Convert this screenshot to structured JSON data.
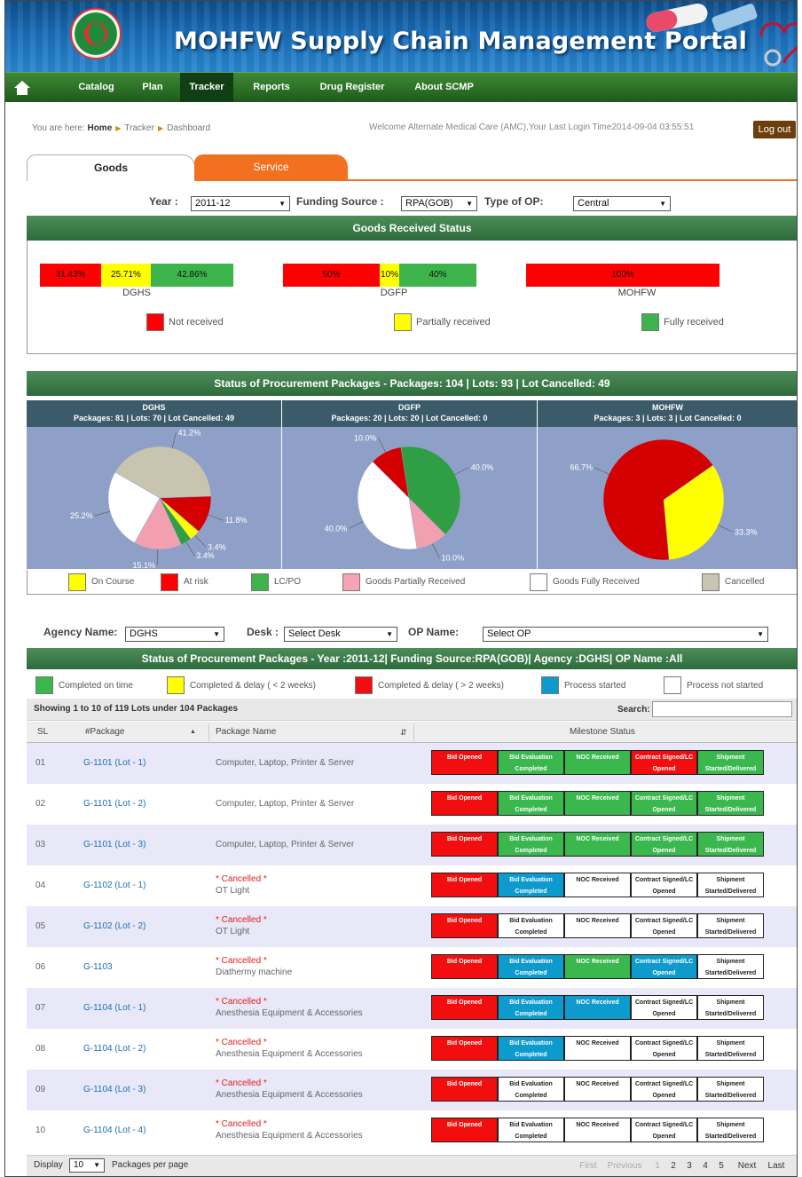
{
  "portal": {
    "title": "MOHFW Supply Chain Management Portal"
  },
  "nav": {
    "items": [
      "Catalog",
      "Plan",
      "Tracker",
      "Reports",
      "Drug Register",
      "About SCMP"
    ],
    "active": "Tracker"
  },
  "breadcrumb": {
    "prefix": "You are here:",
    "home": "Home",
    "tracker": "Tracker",
    "dashboard": "Dashboard"
  },
  "welcome": "Welcome Alternate Medical Care (AMC),Your Last Login Time2014-09-04 03:55:51",
  "logout_label": "Log out",
  "tabs": {
    "goods": "Goods",
    "service": "Service"
  },
  "filters": {
    "year_label": "Year :",
    "year_value": "2011-12",
    "funding_label": "Funding Source :",
    "funding_value": "RPA(GOB)",
    "op_type_label": "Type of OP:",
    "op_type_value": "Central"
  },
  "goods_status": {
    "title": "Goods Received Status",
    "bars": [
      {
        "name": "DGHS",
        "not_received": "31.43%",
        "partial": "25.71%",
        "full": "42.86%",
        "fractions": [
          0.3143,
          0.2571,
          0.4286
        ]
      },
      {
        "name": "DGFP",
        "not_received": "50%",
        "partial": "10%",
        "full": "40%",
        "fractions": [
          0.5,
          0.1,
          0.4
        ]
      },
      {
        "name": "MOHFW",
        "not_received": "100%",
        "partial": "",
        "full": "",
        "fractions": [
          1.0,
          0,
          0
        ]
      }
    ],
    "legend": {
      "not_received": "Not received",
      "partial": "Partially received",
      "full": "Fully received"
    },
    "colors": {
      "not_received": "#ff0000",
      "partial": "#ffff00",
      "full": "#3cb44b"
    }
  },
  "procurement": {
    "title": "Status of Procurement Packages - Packages: 104 | Lots: 93 | Lot Cancelled: 49",
    "panes": [
      {
        "name": "DGHS",
        "sub": "Packages: 81 | Lots: 70 | Lot Cancelled: 49"
      },
      {
        "name": "DGFP",
        "sub": "Packages: 20 | Lots: 20 | Lot Cancelled: 0"
      },
      {
        "name": "MOHFW",
        "sub": "Packages: 3 | Lots: 3 | Lot Cancelled: 0"
      }
    ],
    "legend": [
      "On Course",
      "At risk",
      "LC/PO",
      "Goods Partially Received",
      "Goods Fully Received",
      "Cancelled"
    ],
    "legend_colors": [
      "#ffff00",
      "#ff0000",
      "#3cb44b",
      "#f4a4b4",
      "#ffffff",
      "#c8c4b0"
    ]
  },
  "chart_data": [
    {
      "type": "pie",
      "title": "DGHS",
      "slices": [
        {
          "label": "Cancelled",
          "value": 41.2,
          "text": "41.2%"
        },
        {
          "label": "At risk",
          "value": 11.8,
          "text": "11.8%"
        },
        {
          "label": "On Course",
          "value": 3.4,
          "text": "3.4%"
        },
        {
          "label": "LC/PO",
          "value": 3.4,
          "text": "3.4%"
        },
        {
          "label": "Goods Partially Received",
          "value": 15.1,
          "text": "15.1%"
        },
        {
          "label": "Goods Fully Received",
          "value": 25.2,
          "text": "25.2%"
        }
      ]
    },
    {
      "type": "pie",
      "title": "DGFP",
      "slices": [
        {
          "label": "At risk",
          "value": 10.0,
          "text": "10.0%"
        },
        {
          "label": "LC/PO",
          "value": 40.0,
          "text": "40.0%"
        },
        {
          "label": "Goods Partially Received",
          "value": 10.0,
          "text": "10.0%"
        },
        {
          "label": "Goods Fully Received",
          "value": 40.0,
          "text": "40.0%"
        }
      ]
    },
    {
      "type": "pie",
      "title": "MOHFW",
      "slices": [
        {
          "label": "On Course",
          "value": 33.3,
          "text": "33.3%"
        },
        {
          "label": "At risk",
          "value": 66.7,
          "text": "66.7%"
        }
      ]
    }
  ],
  "agency_filter": {
    "agency_label": "Agency Name:",
    "agency_value": "DGHS",
    "desk_label": "Desk :",
    "desk_value": "Select Desk",
    "op_label": "OP Name:",
    "op_value": "Select OP"
  },
  "status_table": {
    "title": "Status of Procurement Packages - Year :2011-12| Funding Source:RPA(GOB)| Agency :DGHS| OP Name :All",
    "legend": [
      "Completed on time",
      "Completed & delay ( < 2 weeks)",
      "Completed & delay ( > 2 weeks)",
      "Process started",
      "Process not started"
    ],
    "legend_colors": [
      "#3ab74d",
      "#ffff00",
      "#f20e0e",
      "#0d9acd",
      "#ffffff"
    ],
    "showing": "Showing 1 to 10 of 119 Lots under 104 Packages",
    "search_label": "Search:",
    "headers": {
      "sl": "SL",
      "package": "#Package",
      "name": "Package Name",
      "milestone": "Milestone Status"
    },
    "milestones": [
      "Bid Opened",
      "Bid Evaluation Completed",
      "NOC Received",
      "Contract Signed/LC Opened",
      "Shipment Started/Delivered"
    ],
    "rows": [
      {
        "sl": "01",
        "pkg": "G-1101  (Lot - 1)",
        "cancel": "",
        "name": "Computer, Laptop, Printer & Server",
        "status": [
          "red",
          "green",
          "green",
          "red",
          "green"
        ]
      },
      {
        "sl": "02",
        "pkg": "G-1101  (Lot - 2)",
        "cancel": "",
        "name": "Computer, Laptop, Printer & Server",
        "status": [
          "red",
          "green",
          "green",
          "green",
          "green"
        ]
      },
      {
        "sl": "03",
        "pkg": "G-1101  (Lot - 3)",
        "cancel": "",
        "name": "Computer, Laptop, Printer & Server",
        "status": [
          "red",
          "green",
          "green",
          "green",
          "green"
        ]
      },
      {
        "sl": "04",
        "pkg": "G-1102  (Lot - 1)",
        "cancel": "* Cancelled *",
        "name": "OT Light",
        "status": [
          "red",
          "blue",
          "white",
          "white",
          "white"
        ]
      },
      {
        "sl": "05",
        "pkg": "G-1102  (Lot - 2)",
        "cancel": "* Cancelled *",
        "name": "OT Light",
        "status": [
          "red",
          "white",
          "white",
          "white",
          "white"
        ]
      },
      {
        "sl": "06",
        "pkg": "G-1103",
        "cancel": "* Cancelled *",
        "name": "Diathermy machine",
        "status": [
          "red",
          "blue",
          "green",
          "blue",
          "white"
        ]
      },
      {
        "sl": "07",
        "pkg": "G-1104  (Lot - 1)",
        "cancel": "* Cancelled *",
        "name": "Anesthesia Equipment & Accessories",
        "status": [
          "red",
          "blue",
          "blue",
          "white",
          "white"
        ]
      },
      {
        "sl": "08",
        "pkg": "G-1104  (Lot - 2)",
        "cancel": "* Cancelled *",
        "name": "Anesthesia Equipment & Accessories",
        "status": [
          "red",
          "blue",
          "white",
          "white",
          "white"
        ]
      },
      {
        "sl": "09",
        "pkg": "G-1104  (Lot - 3)",
        "cancel": "* Cancelled *",
        "name": "Anesthesia Equipment & Accessories",
        "status": [
          "red",
          "white",
          "white",
          "white",
          "white"
        ]
      },
      {
        "sl": "10",
        "pkg": "G-1104  (Lot - 4)",
        "cancel": "* Cancelled *",
        "name": "Anesthesia Equipment & Accessories",
        "status": [
          "red",
          "white",
          "white",
          "white",
          "white"
        ]
      }
    ]
  },
  "pagination": {
    "display_label": "Display",
    "per_page_value": "10",
    "per_page_suffix": "Packages per page",
    "buttons": [
      "First",
      "Previous",
      "1",
      "2",
      "3",
      "4",
      "5",
      "Next",
      "Last"
    ]
  }
}
